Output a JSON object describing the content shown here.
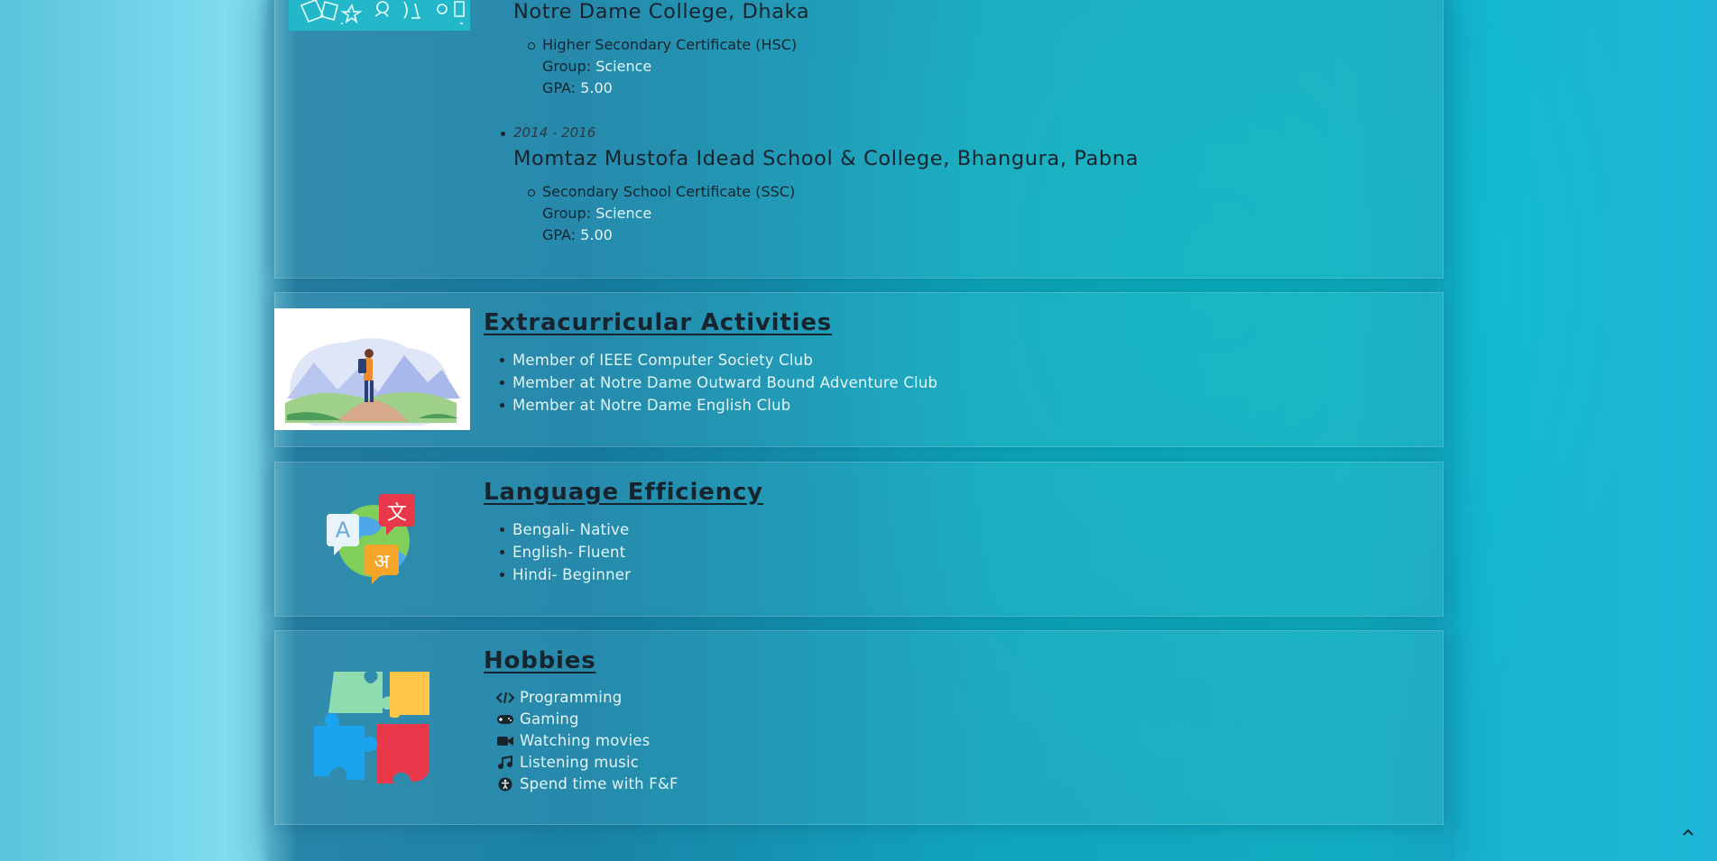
{
  "education": {
    "entries": [
      {
        "years": "",
        "school": "Notre Dame College, Dhaka",
        "degree": "Higher Secondary Certificate (HSC)",
        "group_label": "Group:",
        "group_value": "Science",
        "gpa_label": "GPA:",
        "gpa_value": "5.00"
      },
      {
        "years": "2014 - 2016",
        "school": "Momtaz Mustofa Idead School & College, Bhangura, Pabna",
        "degree": "Secondary School Certificate (SSC)",
        "group_label": "Group:",
        "group_value": "Science",
        "gpa_label": "GPA:",
        "gpa_value": "5.00"
      }
    ]
  },
  "extracurricular": {
    "title": "Extracurricular Activities",
    "items": [
      "Member of IEEE Computer Society Club",
      "Member at Notre Dame Outward Bound Adventure Club",
      "Member at Notre Dame English Club"
    ]
  },
  "language": {
    "title": "Language Efficiency",
    "items": [
      "Bengali- Native",
      "English- Fluent",
      "Hindi- Beginner"
    ]
  },
  "hobbies": {
    "title": "Hobbies",
    "items": [
      {
        "label": "Programming",
        "icon": "code-icon"
      },
      {
        "label": "Gaming",
        "icon": "gamepad-icon"
      },
      {
        "label": "Watching movies",
        "icon": "video-camera-icon"
      },
      {
        "label": "Listening music",
        "icon": "music-note-icon"
      },
      {
        "label": "Spend time with F&F",
        "icon": "universal-access-icon"
      }
    ]
  },
  "icons": {
    "language_glyph_1": "A",
    "language_glyph_2": "文",
    "language_glyph_3": "अ"
  },
  "colors": {
    "background_accent": "#10bfd0",
    "text_light": "#e2f5f7",
    "text_dark": "#17242e"
  }
}
